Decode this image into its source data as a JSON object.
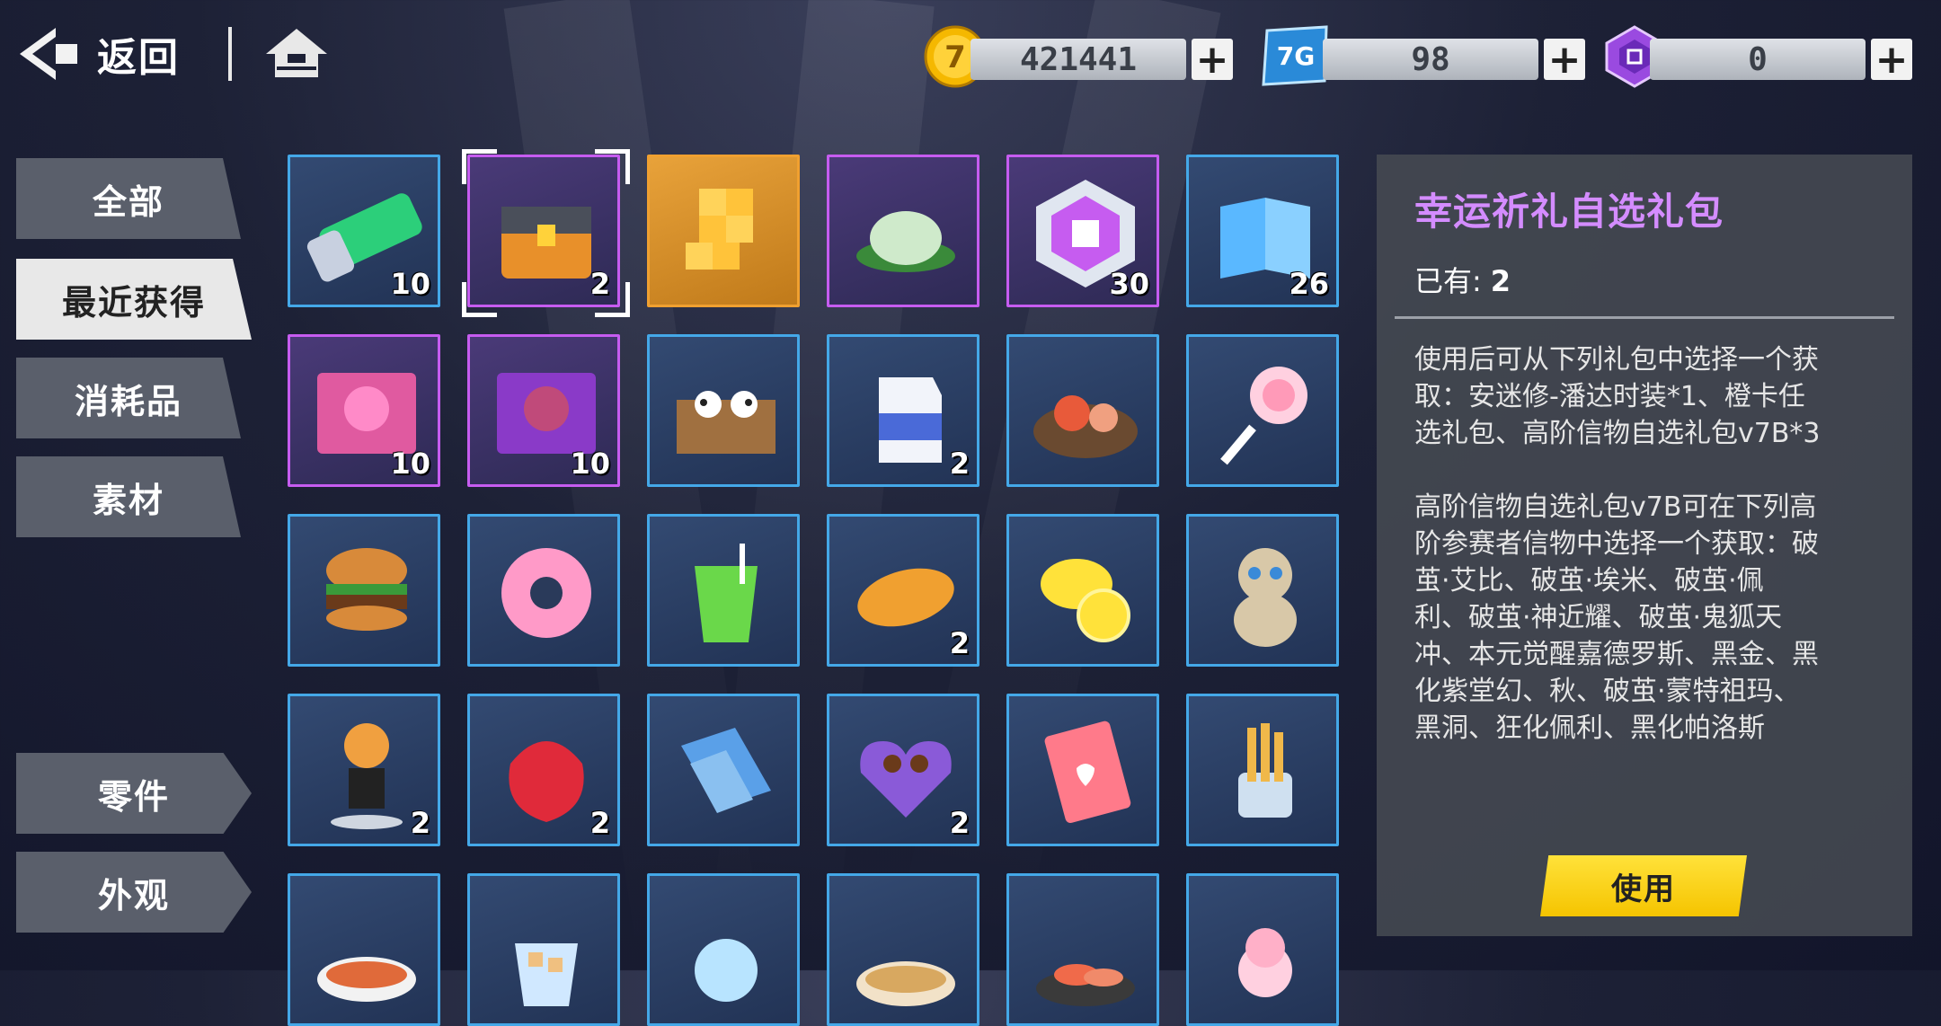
{
  "header": {
    "back_label": "返回"
  },
  "currencies": [
    {
      "name": "coin",
      "value": "421441"
    },
    {
      "name": "7g-card",
      "value": "98",
      "icon_text": "7G"
    },
    {
      "name": "gem",
      "value": "0"
    }
  ],
  "tabs": [
    "全部",
    "最近获得",
    "消耗品",
    "素材",
    "零件",
    "外观"
  ],
  "active_tab": "最近获得",
  "items": [
    {
      "rarity": "blue",
      "count": "10",
      "icon": "green-tube-icon"
    },
    {
      "rarity": "purple",
      "count": "2",
      "icon": "treasure-chest-icon",
      "selected": true
    },
    {
      "rarity": "gold",
      "count": "",
      "icon": "gold-cubes-icon"
    },
    {
      "rarity": "purple",
      "count": "",
      "icon": "rice-cake-icon"
    },
    {
      "rarity": "purple",
      "count": "30",
      "icon": "outfit-hexagon-icon"
    },
    {
      "rarity": "blue",
      "count": "26",
      "icon": "book-icon"
    },
    {
      "rarity": "purple",
      "count": "10",
      "icon": "pink-card-icon"
    },
    {
      "rarity": "purple",
      "count": "10",
      "icon": "dark-card-icon"
    },
    {
      "rarity": "blue",
      "count": "",
      "icon": "panda-bento-icon"
    },
    {
      "rarity": "blue",
      "count": "2",
      "icon": "milk-carton-icon"
    },
    {
      "rarity": "blue",
      "count": "",
      "icon": "seafood-platter-icon"
    },
    {
      "rarity": "blue",
      "count": "",
      "icon": "lollipop-icon"
    },
    {
      "rarity": "blue",
      "count": "",
      "icon": "burger-icon"
    },
    {
      "rarity": "blue",
      "count": "",
      "icon": "donut-icon"
    },
    {
      "rarity": "blue",
      "count": "",
      "icon": "green-juice-icon"
    },
    {
      "rarity": "blue",
      "count": "2",
      "icon": "mango-icon"
    },
    {
      "rarity": "blue",
      "count": "",
      "icon": "lemon-icon"
    },
    {
      "rarity": "blue",
      "count": "",
      "icon": "cat-figure-icon"
    },
    {
      "rarity": "blue",
      "count": "2",
      "icon": "chibi-figure-icon"
    },
    {
      "rarity": "blue",
      "count": "2",
      "icon": "red-rose-icon"
    },
    {
      "rarity": "blue",
      "count": "",
      "icon": "ticket-icon"
    },
    {
      "rarity": "blue",
      "count": "2",
      "icon": "chocolate-box-icon"
    },
    {
      "rarity": "blue",
      "count": "",
      "icon": "red-envelope-icon"
    },
    {
      "rarity": "blue",
      "count": "",
      "icon": "fries-icon"
    },
    {
      "rarity": "blue",
      "count": "",
      "icon": "soup-icon"
    },
    {
      "rarity": "blue",
      "count": "",
      "icon": "ice-drink-icon"
    },
    {
      "rarity": "blue",
      "count": "",
      "icon": "cotton-candy-icon"
    },
    {
      "rarity": "blue",
      "count": "",
      "icon": "noodle-bowl-icon"
    },
    {
      "rarity": "blue",
      "count": "",
      "icon": "sashimi-icon"
    },
    {
      "rarity": "blue",
      "count": "",
      "icon": "ice-cream-icon"
    }
  ],
  "detail": {
    "title": "幸运祈礼自选礼包",
    "owned_label": "已有:",
    "owned_value": "2",
    "desc_lines": [
      "使用后可从下列礼包中选择一个获",
      "取：安迷修-潘达时装*1、橙卡任",
      "选礼包、高阶信物自选礼包v7B*3",
      "",
      "高阶信物自选礼包v7B可在下列高",
      "阶参赛者信物中选择一个获取：破",
      "茧·艾比、破茧·埃米、破茧·佩",
      "利、破茧·神近耀、破茧·鬼狐天",
      "冲、本元觉醒嘉德罗斯、黑金、黑",
      "化紫堂幻、秋、破茧·蒙特祖玛、",
      "黑洞、狂化佩利、黑化帕洛斯"
    ],
    "use_label": "使用"
  },
  "colors": {
    "accent_title": "#d48cff",
    "use_button": "#ffd21a",
    "rarity_blue": "#44a8e8",
    "rarity_purple": "#c65cf0",
    "rarity_gold": "#f0a030"
  }
}
